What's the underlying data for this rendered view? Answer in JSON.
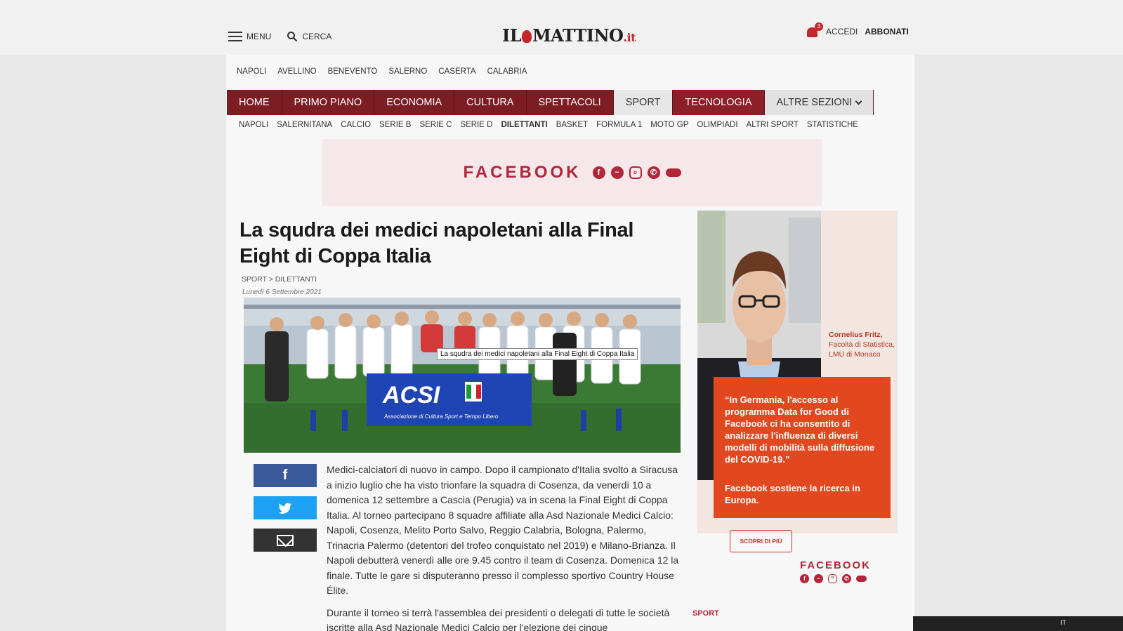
{
  "header": {
    "menu_label": "MENU",
    "search_label": "CERCA",
    "logo_left": "IL",
    "logo_right": "MATTINO",
    "logo_domain": ".it",
    "notification_count": "3",
    "login_label": "ACCEDI",
    "subscribe_label": "ABBONATI"
  },
  "cities": [
    "NAPOLI",
    "AVELLINO",
    "BENEVENTO",
    "SALERNO",
    "CASERTA",
    "CALABRIA"
  ],
  "nav": {
    "tabs": [
      "HOME",
      "PRIMO PIANO",
      "ECONOMIA",
      "CULTURA",
      "SPETTACOLI",
      "SPORT",
      "TECNOLOGIA"
    ],
    "more_label": "ALTRE SEZIONI"
  },
  "subnav": [
    "NAPOLI",
    "SALERNITANA",
    "CALCIO",
    "SERIE B",
    "SERIE C",
    "SERIE D",
    "DILETTANTI",
    "BASKET",
    "FORMULA 1",
    "MOTO GP",
    "OLIMPIADI",
    "ALTRI SPORT",
    "STATISTICHE"
  ],
  "banner": {
    "brand": "FACEBOOK"
  },
  "article": {
    "title": "La squdra dei medici napoletani alla Final Eight di Coppa Italia",
    "breadcrumb": "SPORT > DILETTANTI",
    "date": "Lunedì 6 Settembre 2021",
    "image_tooltip": "La squdra dei medici napoletani alla Final Eight di Coppa Italia",
    "banner_text": "ACSI",
    "banner_sub": "Associazione di Cultura Sport e Tempo Libero",
    "paragraph1": "Medici-calciatori di nuovo in campo. Dopo il campionato d'Italia svolto a Siracusa a inizio luglio che ha visto trionfare la squadra di Cosenza, da venerdì 10 a domenica 12 settembre a Cascia (Perugia) va in scena la Final Eight di Coppa Italia. Al torneo partecipano 8 squadre affiliate alla Asd Nazionale Medici Calcio: Napoli, Cosenza, Melito Porto Salvo, Reggio Calabria, Bologna, Palermo, Trinacria Palermo (detentori del trofeo conquistato nel 2019) e Milano-Brianza. Il Napoli debutterà venerdì alle ore 9.45 contro il team di Cosenza. Domenica 12 la finale. Tutte le gare si disputeranno presso il complesso sportivo Country House Élite.",
    "paragraph2": "Durante il torneo si terrà l'assemblea dei presidenti o delegati di tutte le società iscritte alla Asd Nazionale Medici Calcio per l'elezione dei cinque"
  },
  "ad": {
    "person_name": "Cornelius Fritz,",
    "person_role": "Facoltà di Statistica, LMU di Monaco",
    "quote": "“In Germania, l'accesso al programma Data for Good di Facebook ci ha consentito di analizzare l'influenza di diversi modelli di mobilità sulla diffusione del COVID-19.”",
    "tagline": "Facebook sostiene la ricerca in Europa.",
    "cta": "SCOPRI DI PIÙ",
    "brand": "FACEBOOK"
  },
  "section_tag": "SPORT",
  "system": {
    "lang": "IT"
  },
  "colors": {
    "brand_red": "#7b1d23",
    "facebook_pink": "#b2263a",
    "ad_orange": "#e2481f"
  }
}
